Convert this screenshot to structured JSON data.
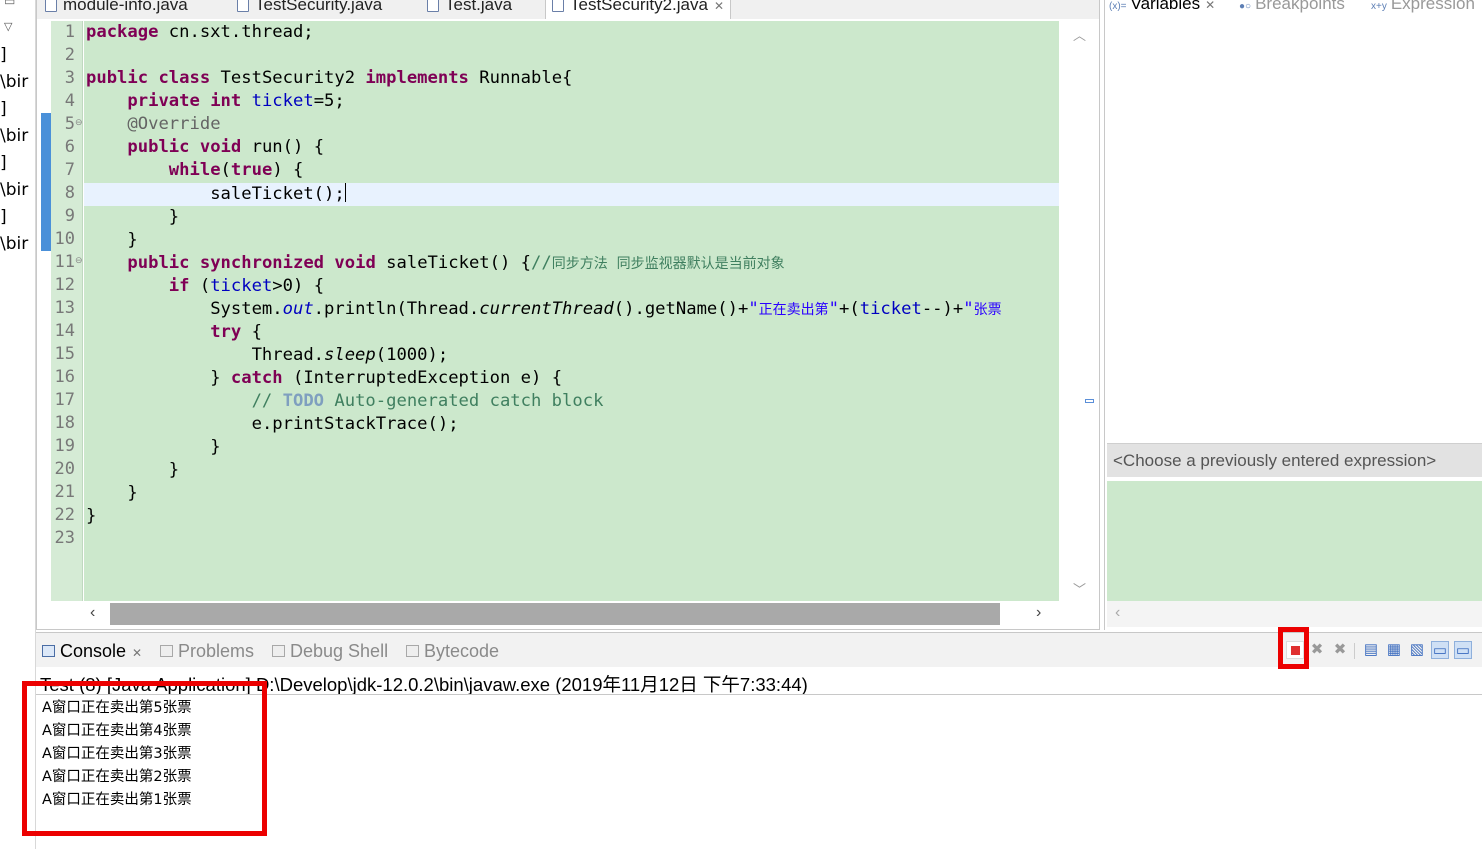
{
  "left_strip": {
    "rows": [
      "]",
      "\\bir",
      "]",
      "\\bir",
      "]",
      "\\bir",
      "]",
      "\\bir"
    ]
  },
  "editor": {
    "tabs": [
      {
        "label": "module-info.java",
        "active": false
      },
      {
        "label": "TestSecurity.java",
        "active": false
      },
      {
        "label": "Test.java",
        "active": false
      },
      {
        "label": "TestSecurity2.java",
        "active": true
      }
    ],
    "line_numbers": [
      "1",
      "2",
      "3",
      "4",
      "5",
      "6",
      "7",
      "8",
      "9",
      "10",
      "11",
      "12",
      "13",
      "14",
      "15",
      "16",
      "17",
      "18",
      "19",
      "20",
      "21",
      "22",
      "23"
    ],
    "code": {
      "l1_kw": "package",
      "l1_rest": " cn.sxt.thread;",
      "l3_kw1": "public",
      "l3_kw2": "class",
      "l3_name": " TestSecurity2 ",
      "l3_kw3": "implements",
      "l3_rest": " Runnable{",
      "l4_kw1": "private",
      "l4_kw2": "int",
      "l4_field": "ticket",
      "l4_rest": "=5;",
      "l5_ann": "@Override",
      "l6_kw1": "public",
      "l6_kw2": "void",
      "l6_rest": " run() {",
      "l7_kw1": "while",
      "l7_kw2": "true",
      "l7_open": "(",
      "l7_close": ") {",
      "l8_text": "saleTicket();",
      "l9_text": "}",
      "l10_text": "}",
      "l11_kw1": "public",
      "l11_kw2": "synchronized",
      "l11_kw3": "void",
      "l11_rest": " saleTicket() {",
      "l11_comment_slashes": "//",
      "l11_comment": "同步方法  同步监视器默认是当前对象",
      "l12_kw": "if",
      "l12_open": " (",
      "l12_field": "ticket",
      "l12_rest": ">0) {",
      "l13_a": "System.",
      "l13_out": "out",
      "l13_b": ".println(Thread.",
      "l13_ct": "currentThread",
      "l13_c": "().getName()+",
      "l13_q1": "\"",
      "l13_s1": "正在卖出第",
      "l13_q2": "\"",
      "l13_d": "+(",
      "l13_field": "ticket",
      "l13_e": "--)+",
      "l13_q3": "\"",
      "l13_s2": "张票",
      "l14_kw": "try",
      "l14_rest": " {",
      "l15_a": "Thread.",
      "l15_sleep": "sleep",
      "l15_b": "(1000);",
      "l16_a": "} ",
      "l16_kw": "catch",
      "l16_b": " (InterruptedException ",
      "l16_e": "e",
      "l16_c": ") {",
      "l17_slashes": "// ",
      "l17_todo": "TODO",
      "l17_rest": " Auto-generated catch block",
      "l18_e": "e",
      "l18_rest": ".printStackTrace();",
      "l19_text": "}",
      "l20_text": "}",
      "l21_text": "}",
      "l22_text": "}"
    }
  },
  "right_pane": {
    "tabs": [
      {
        "label": "Variables",
        "active": true
      },
      {
        "label": "Breakpoints",
        "active": false
      },
      {
        "label": "Expression",
        "active": false
      }
    ],
    "expression_placeholder": "<Choose a previously entered expression>"
  },
  "console": {
    "tabs": [
      {
        "label": "Console",
        "active": true
      },
      {
        "label": "Problems",
        "active": false
      },
      {
        "label": "Debug Shell",
        "active": false
      },
      {
        "label": "Bytecode",
        "active": false
      }
    ],
    "description": "Test (8) [Java Application] D:\\Develop\\jdk-12.0.2\\bin\\javaw.exe (2019年11月12日 下午7:33:44)",
    "output": [
      "A窗口正在卖出第5张票",
      "A窗口正在卖出第4张票",
      "A窗口正在卖出第3张票",
      "A窗口正在卖出第2张票",
      "A窗口正在卖出第1张票"
    ]
  },
  "highlight_color": "#ec0000"
}
